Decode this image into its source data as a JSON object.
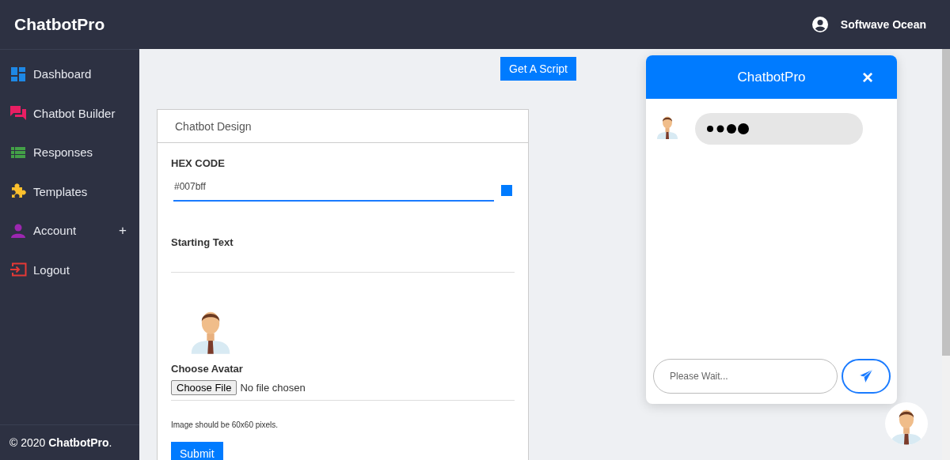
{
  "header": {
    "brand": "ChatbotPro",
    "user": "Softwave Ocean"
  },
  "sidebar": {
    "items": [
      {
        "label": "Dashboard",
        "selected": false
      },
      {
        "label": "Chatbot Builder",
        "selected": false
      },
      {
        "label": "Responses",
        "selected": false
      },
      {
        "label": "Templates",
        "selected": false
      },
      {
        "label": "Account",
        "selected": false,
        "toggle": "+"
      },
      {
        "label": "Logout",
        "selected": false
      }
    ],
    "footer": "© 2020 **ChatbotPro**."
  },
  "toolbar": {
    "button": "Get A Script"
  },
  "design_card": {
    "title": "Chatbot Design",
    "hex_label": "HEX CODE",
    "hex_value": "#007bff",
    "starting_text_label": "Starting Text",
    "avatar_label": "Choose Avatar",
    "file_button": "Choose File",
    "file_status": "No file chosen",
    "hint": "Image should be 60x60 pixels.",
    "submit": "Submit"
  },
  "chat_widget": {
    "title": "ChatbotPro",
    "close": "×",
    "typing": true,
    "placeholder": "Please Wait..."
  }
}
